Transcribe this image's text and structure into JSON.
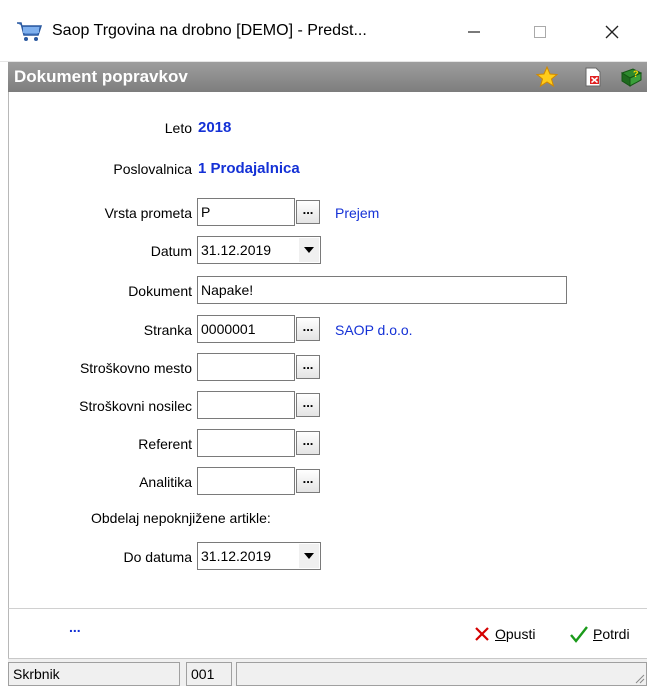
{
  "window": {
    "title": "Saop Trgovina na drobno [DEMO] - Predst...",
    "app_icon": "shopping-cart-icon"
  },
  "header": {
    "title": "Dokument popravkov",
    "icons": [
      "star-icon",
      "delete-document-icon",
      "help-book-icon"
    ]
  },
  "form": {
    "leto": {
      "label": "Leto",
      "value": "2018"
    },
    "poslovalnica": {
      "label": "Poslovalnica",
      "value": "1 Prodajalnica"
    },
    "vrsta_prometa": {
      "label": "Vrsta prometa",
      "value": "P",
      "description": "Prejem"
    },
    "datum": {
      "label": "Datum",
      "value": "31.12.2019"
    },
    "dokument": {
      "label": "Dokument",
      "value": "Napake!"
    },
    "stranka": {
      "label": "Stranka",
      "value": "0000001",
      "description": "SAOP d.o.o."
    },
    "stroskovno_mesto": {
      "label": "Stroškovno mesto",
      "value": ""
    },
    "stroskovni_nosilec": {
      "label": "Stroškovni nosilec",
      "value": ""
    },
    "referent": {
      "label": "Referent",
      "value": ""
    },
    "analitika": {
      "label": "Analitika",
      "value": ""
    },
    "section_label": "Obdelaj nepoknjižene artikle:",
    "do_datuma": {
      "label": "Do datuma",
      "value": "31.12.2019"
    },
    "lookup_glyph": "..."
  },
  "actions": {
    "more": "...",
    "cancel": {
      "first": "O",
      "rest": "pusti"
    },
    "confirm": {
      "first": "P",
      "rest": "otrdi"
    }
  },
  "statusbar": {
    "user": "Skrbnik",
    "code": "001",
    "extra": ""
  },
  "colors": {
    "accent_blue": "#1431d6",
    "header_gray": "#8a8a8a",
    "cancel_red": "#d40000",
    "confirm_green": "#1a9a1a"
  }
}
